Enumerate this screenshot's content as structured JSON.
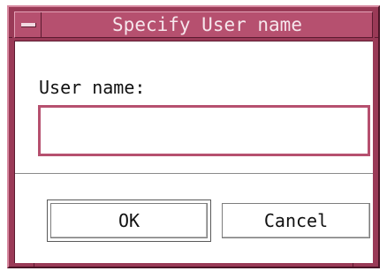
{
  "dialog": {
    "title": "Specify User name",
    "field_label": "User name:",
    "field_value": "",
    "ok_label": "OK",
    "cancel_label": "Cancel"
  },
  "colors": {
    "frame": "#9a3a57",
    "titlebar": "#b6506f",
    "title_text": "#f6e6ec",
    "input_border": "#b6506f",
    "client_bg": "#ffffff"
  },
  "icons": {
    "window_menu": "window-menu-icon"
  }
}
